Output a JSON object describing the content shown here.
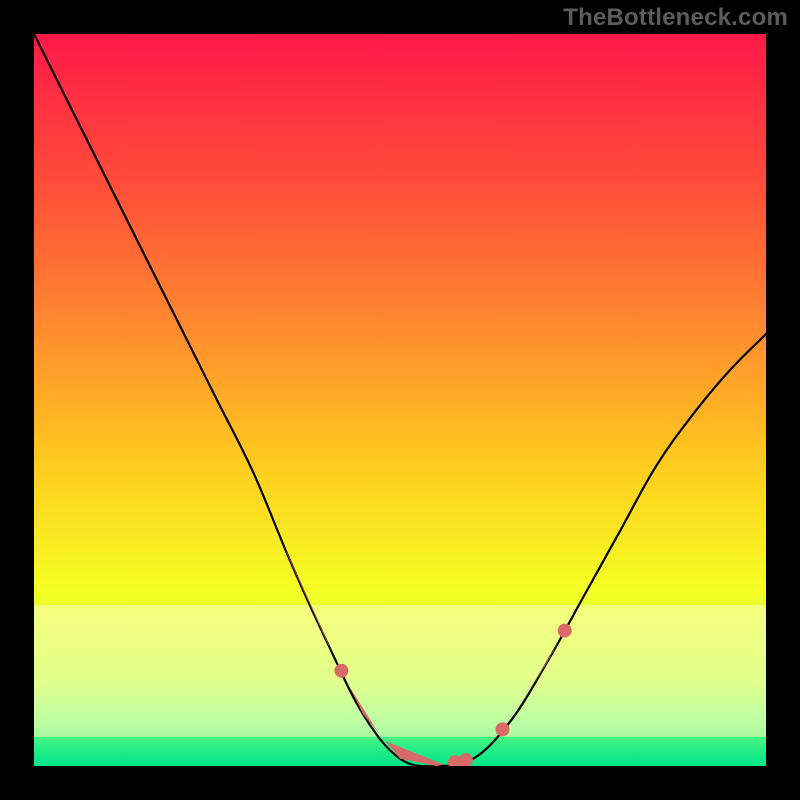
{
  "watermark": "TheBottleneck.com",
  "chart_data": {
    "type": "line",
    "title": "",
    "xlabel": "",
    "ylabel": "",
    "xlim": [
      0,
      100
    ],
    "ylim": [
      0,
      100
    ],
    "grid": false,
    "legend": false,
    "background": {
      "type": "vertical-gradient",
      "stops": [
        {
          "offset": 0.0,
          "color": "#ff1948"
        },
        {
          "offset": 0.2,
          "color": "#ff4c3a"
        },
        {
          "offset": 0.4,
          "color": "#ff8a2f"
        },
        {
          "offset": 0.58,
          "color": "#ffc91f"
        },
        {
          "offset": 0.76,
          "color": "#f5ff24"
        },
        {
          "offset": 0.88,
          "color": "#bfff4b"
        },
        {
          "offset": 0.93,
          "color": "#7bff7a"
        },
        {
          "offset": 1.0,
          "color": "#00e58a"
        }
      ],
      "glow_band": {
        "y_start": 0.78,
        "y_end": 0.96,
        "color": "#ffffc0",
        "opacity": 0.55
      }
    },
    "series": [
      {
        "name": "bottleneck-curve",
        "x": [
          0,
          5,
          10,
          15,
          20,
          25,
          30,
          35,
          40,
          45,
          50,
          55,
          60,
          65,
          70,
          75,
          80,
          85,
          90,
          95,
          100
        ],
        "value": [
          100,
          90,
          80,
          70,
          60,
          50,
          40,
          28,
          17,
          7,
          1,
          0,
          1,
          6,
          14,
          23,
          32,
          41,
          48,
          54,
          59
        ]
      }
    ],
    "markers": {
      "name": "highlighted-points",
      "color": "#d86a68",
      "segments": [
        {
          "x_range": [
            30,
            34
          ],
          "shape": "capsule"
        },
        {
          "x_range": [
            34,
            41
          ],
          "shape": "capsule"
        },
        {
          "x_range": [
            41,
            43
          ],
          "shape": "dot"
        },
        {
          "x_range": [
            43,
            47
          ],
          "shape": "capsule"
        },
        {
          "x_range": [
            48,
            56
          ],
          "shape": "capsule"
        },
        {
          "x_range": [
            57,
            58
          ],
          "shape": "dot"
        },
        {
          "x_range": [
            58,
            60
          ],
          "shape": "dot"
        },
        {
          "x_range": [
            60,
            62
          ],
          "shape": "capsule"
        },
        {
          "x_range": [
            63,
            65
          ],
          "shape": "dot"
        },
        {
          "x_range": [
            65,
            67
          ],
          "shape": "capsule"
        },
        {
          "x_range": [
            68,
            72
          ],
          "shape": "capsule"
        },
        {
          "x_range": [
            72,
            73
          ],
          "shape": "dot"
        }
      ]
    }
  }
}
